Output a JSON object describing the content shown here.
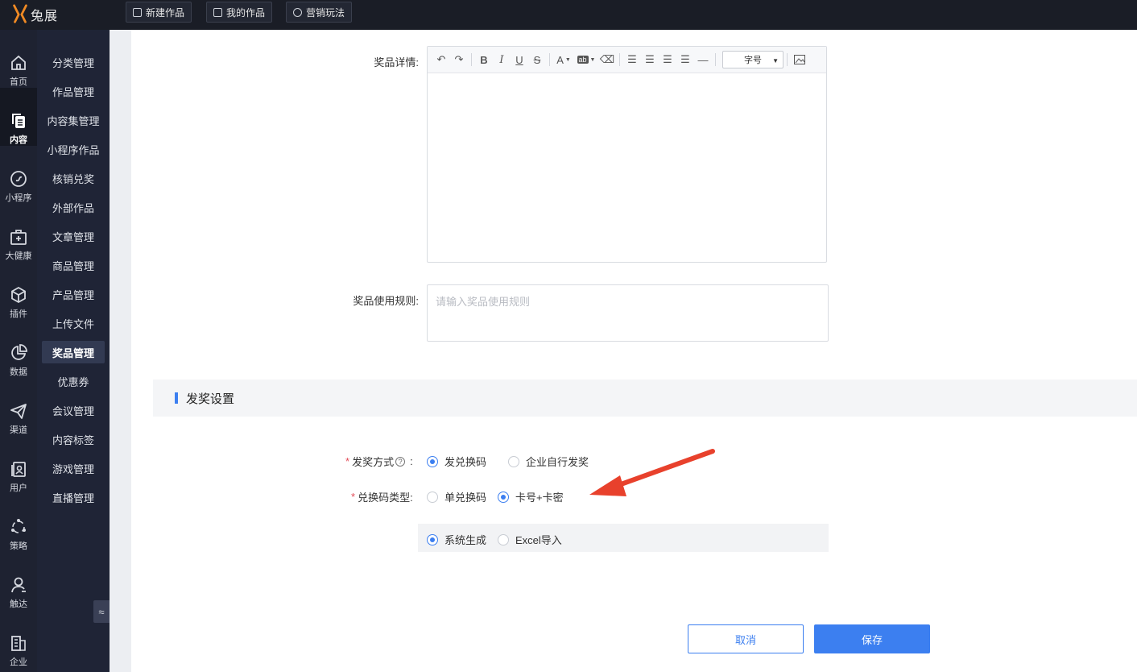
{
  "top_nav": {
    "brand": "兔展",
    "buttons": [
      {
        "label": "新建作品",
        "icon": "plus-square-icon"
      },
      {
        "label": "我的作品",
        "icon": "list-square-icon"
      },
      {
        "label": "营销玩法",
        "icon": "cube-icon"
      }
    ]
  },
  "rail": {
    "items": [
      {
        "label": "首页",
        "icon": "home-icon"
      },
      {
        "label": "内容",
        "icon": "copy-icon",
        "active": true
      },
      {
        "label": "小程序",
        "icon": "link-icon"
      },
      {
        "label": "大健康",
        "icon": "medical-kit-icon"
      },
      {
        "label": "插件",
        "icon": "cube-icon"
      },
      {
        "label": "数据",
        "icon": "pie-chart-icon"
      },
      {
        "label": "渠道",
        "icon": "send-icon"
      },
      {
        "label": "用户",
        "icon": "user-card-icon"
      },
      {
        "label": "策略",
        "icon": "strategy-icon"
      },
      {
        "label": "触达",
        "icon": "person-icon"
      },
      {
        "label": "企业",
        "icon": "building-icon"
      }
    ]
  },
  "submenu": {
    "items": [
      "分类管理",
      "作品管理",
      "内容集管理",
      "小程序作品",
      "核销兑奖",
      "外部作品",
      "文章管理",
      "商品管理",
      "产品管理",
      "上传文件",
      "奖品管理",
      "优惠券",
      "会议管理",
      "内容标签",
      "游戏管理",
      "直播管理"
    ],
    "active_index": 10,
    "collapse_glyph": "≈"
  },
  "form": {
    "detail_label": "奖品详情:",
    "font_size_select": "字号",
    "rules_label": "奖品使用规则:",
    "rules_placeholder": "请输入奖品使用规则",
    "section_title": "发奖设置",
    "method": {
      "label": "发奖方式",
      "colon": ":",
      "options": [
        "发兑换码",
        "企业自行发奖"
      ],
      "selected": 0
    },
    "code_type": {
      "label": "兑换码类型:",
      "options": [
        "单兑换码",
        "卡号+卡密"
      ],
      "selected": 1
    },
    "generation": {
      "options": [
        "系统生成",
        "Excel导入"
      ],
      "selected": 0
    },
    "cancel_label": "取消",
    "save_label": "保存"
  },
  "colors": {
    "accent": "#3c7ff0",
    "annotation_arrow": "#e8412c"
  }
}
